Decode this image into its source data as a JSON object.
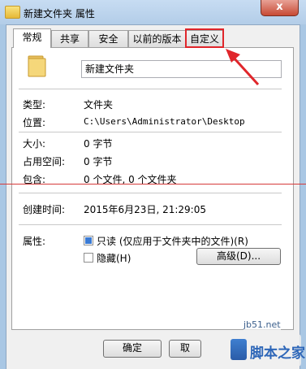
{
  "window": {
    "title": "新建文件夹 属性",
    "close_label": "x"
  },
  "tabs": [
    {
      "label": "常规",
      "active": true
    },
    {
      "label": "共享"
    },
    {
      "label": "安全"
    },
    {
      "label": "以前的版本"
    },
    {
      "label": "自定义",
      "highlighted": true
    }
  ],
  "general": {
    "folder_name": "新建文件夹",
    "type_label": "类型:",
    "type_value": "文件夹",
    "location_label": "位置:",
    "location_value": "C:\\Users\\Administrator\\Desktop",
    "size_label": "大小:",
    "size_value": "0 字节",
    "size_on_disk_label": "占用空间:",
    "size_on_disk_value": "0 字节",
    "contains_label": "包含:",
    "contains_value": "0 个文件, 0 个文件夹",
    "created_label": "创建时间:",
    "created_value": "2015年6月23日, 21:29:05",
    "attributes_label": "属性:",
    "readonly_label": "只读 (仅应用于文件夹中的文件)(R)",
    "hidden_label": "隐藏(H)",
    "advanced_label": "高级(D)..."
  },
  "footer": {
    "ok_label": "确定",
    "cancel_label": "取"
  },
  "watermark": {
    "site": "jb51.net",
    "brand": "脚本之家"
  },
  "colors": {
    "highlight": "#e0262b",
    "titlebar": "#b9d1ea",
    "close_button": "#c74a34"
  }
}
